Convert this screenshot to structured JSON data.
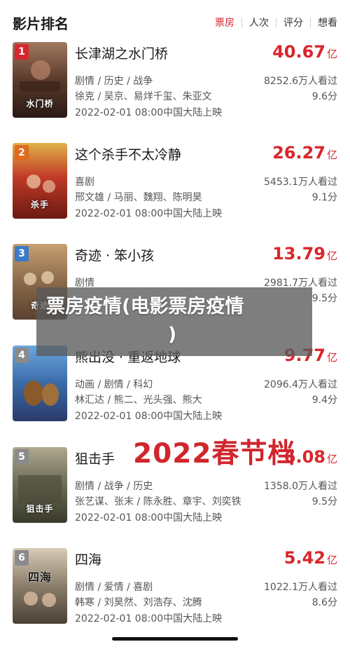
{
  "header": {
    "title": "影片排名",
    "tabs": [
      "票房",
      "人次",
      "评分",
      "想看"
    ]
  },
  "movies": [
    {
      "rank": "1",
      "poster_title": "水门桥",
      "name": "长津湖之水门桥",
      "box_value": "40.67",
      "box_unit": "亿",
      "genre": "剧情 / 历史 / 战争",
      "cast": "徐克 / 吴京、易烊千玺、朱亚文",
      "date": "2022-02-01 08:00中国大陆上映",
      "views": "8252.6万人看过",
      "score": "9.6分"
    },
    {
      "rank": "2",
      "poster_title": "杀手",
      "name": "这个杀手不太冷静",
      "box_value": "26.27",
      "box_unit": "亿",
      "genre": "喜剧",
      "cast": "邢文雄 / 马丽、魏翔、陈明昊",
      "date": "2022-02-01 08:00中国大陆上映",
      "views": "5453.1万人看过",
      "score": "9.1分"
    },
    {
      "rank": "3",
      "poster_title": "奇迹",
      "name": "奇迹 · 笨小孩",
      "box_value": "13.79",
      "box_unit": "亿",
      "genre": "剧情",
      "cast": "",
      "date": "",
      "views": "2981.7万人看过",
      "score": "9.5分"
    },
    {
      "rank": "4",
      "poster_title": "",
      "name": "熊出没 · 重返地球",
      "box_value": "9.77",
      "box_unit": "亿",
      "genre": "动画 / 剧情 / 科幻",
      "cast": "林汇达 / 熊二、光头强、熊大",
      "date": "2022-02-01 08:00中国大陆上映",
      "views": "2096.4万人看过",
      "score": "9.4分"
    },
    {
      "rank": "5",
      "poster_title": "狙击手",
      "name": "狙击手",
      "box_value": "6.08",
      "box_unit": "亿",
      "genre": "剧情 / 战争 / 历史",
      "cast": "张艺谋、张末 / 陈永胜、章宇、刘奕铁",
      "date": "2022-02-01 08:00中国大陆上映",
      "views": "1358.0万人看过",
      "score": "9.5分"
    },
    {
      "rank": "6",
      "poster_title": "四海",
      "name": "四海",
      "box_value": "5.42",
      "box_unit": "亿",
      "genre": "剧情 / 爱情 / 喜剧",
      "cast": "韩寒 / 刘昊然、刘浩存、沈腾",
      "date": "2022-02-01 08:00中国大陆上映",
      "views": "1022.1万人看过",
      "score": "8.6分"
    }
  ],
  "overlay": {
    "line1": "票房疫情(电影票房疫情",
    "line2": ")"
  },
  "watermark": "2022春节档",
  "colors": {
    "accent": "#d9262c",
    "text": "#1a1a1a",
    "meta": "#555555",
    "posters": [
      "#6b4a3a",
      "#b33a2a",
      "#7a6a5a",
      "#3a6aa8",
      "#6a6a55",
      "#8a7d6a"
    ]
  }
}
